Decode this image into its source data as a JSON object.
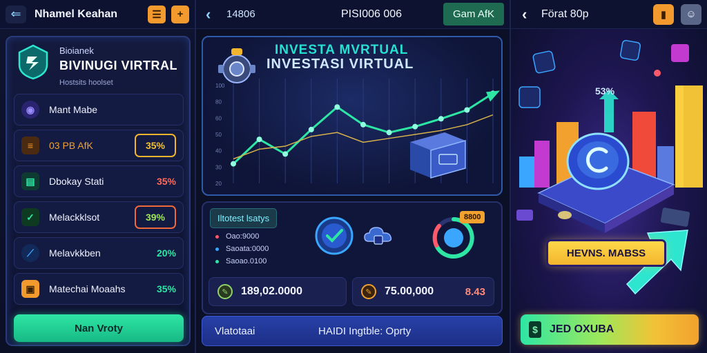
{
  "left_panel": {
    "topbar": {
      "title": "Nhamel Keahan",
      "icon_a": "☰",
      "icon_b": "+"
    },
    "brand": {
      "subtitle": "Bioianek",
      "title": "BIVINUGI VIRTRAL",
      "note": "Hostsits hoolset"
    },
    "rows": [
      {
        "label": "Mant Mabe",
        "value": "",
        "icon": "◉",
        "color": "#7a6cff"
      },
      {
        "label": "03 PB AfK",
        "value": "35%",
        "icon": "≡",
        "color": "#f29a2e",
        "value_color": "#f2c236"
      },
      {
        "label": "Dbokay Stati",
        "value": "35%",
        "icon": "▤",
        "color": "#2ee6a4",
        "value_color": "#ff6a5a"
      },
      {
        "label": "Melackklsot",
        "value": "39%",
        "icon": "✓",
        "color": "#2ee6a4",
        "value_color": "#9ee85a"
      },
      {
        "label": "Melavkkben",
        "value": "20%",
        "icon": "⟋",
        "color": "#3aa6ff",
        "value_color": "#2ee6a4"
      },
      {
        "label": "Matechai Moaahs",
        "value": "35%",
        "icon": "▣",
        "color": "#f29a2e",
        "value_color": "#2ee6a4"
      }
    ],
    "cta": "Nan Vroty"
  },
  "mid_panel": {
    "topbar": {
      "code": "14806",
      "center": "PISI006 006",
      "game_button": "Gam AfK"
    },
    "chart": {
      "title_line1": "INVESTA MVRTUAL",
      "title_line2": "INVESTASI VIRTUAL",
      "y_ticks": [
        "100",
        "80",
        "60",
        "50",
        "40",
        "30",
        "20"
      ]
    },
    "stats": {
      "tag": "Iltotest lsatys",
      "items": [
        {
          "text": "Oao:9000",
          "color": "#ff5a6a"
        },
        {
          "text": "Saoata:0000",
          "color": "#3aa6ff"
        },
        {
          "text": "Saoao.0100",
          "color": "#2ee6a4"
        }
      ],
      "badge": "8800"
    },
    "pills": [
      {
        "value": "189,02.0000",
        "extra": ""
      },
      {
        "value": "75.00,000",
        "extra": "8.43"
      }
    ],
    "bottom": {
      "left": "Vlatotaai",
      "right": "HAIDI Ingtble: Oprty"
    }
  },
  "right_panel": {
    "topbar": {
      "title": "Förat 80p"
    },
    "percent_badge": "53%",
    "banner": "HEVNS. MABSS",
    "cta": {
      "icon": "$",
      "label": "JED OXUBA"
    }
  },
  "chart_data": {
    "type": "line",
    "x": [
      0,
      1,
      2,
      3,
      4,
      5,
      6,
      7,
      8,
      9,
      10
    ],
    "series": [
      {
        "values": [
          20,
          45,
          30,
          55,
          78,
          60,
          52,
          58,
          66,
          75,
          92
        ]
      },
      {
        "values": [
          25,
          35,
          38,
          48,
          52,
          42,
          46,
          50,
          54,
          60,
          70
        ]
      }
    ],
    "ylim": [
      0,
      100
    ]
  }
}
